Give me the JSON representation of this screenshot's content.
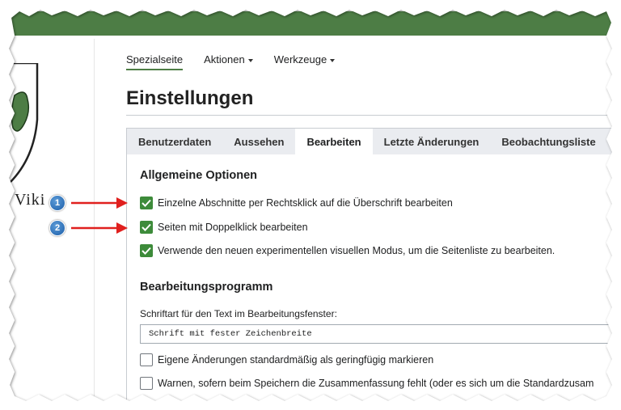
{
  "logo": {
    "text": "Viki"
  },
  "topnav": {
    "items": [
      {
        "label": "Spezialseite"
      },
      {
        "label": "Aktionen"
      },
      {
        "label": "Werkzeuge"
      }
    ]
  },
  "page": {
    "title": "Einstellungen"
  },
  "tabs": [
    {
      "label": "Benutzerdaten"
    },
    {
      "label": "Aussehen"
    },
    {
      "label": "Bearbeiten"
    },
    {
      "label": "Letzte Änderungen"
    },
    {
      "label": "Beobachtungsliste"
    }
  ],
  "general": {
    "title": "Allgemeine Optionen",
    "options": [
      {
        "label": "Einzelne Abschnitte per Rechtsklick auf die Überschrift bearbeiten",
        "checked": true
      },
      {
        "label": "Seiten mit Doppelklick bearbeiten",
        "checked": true
      },
      {
        "label": "Verwende den neuen experimentellen visuellen Modus, um die Seitenliste zu bearbeiten.",
        "checked": true
      }
    ]
  },
  "editor": {
    "title": "Bearbeitungsprogramm",
    "font_label": "Schriftart für den Text im Bearbeitungsfenster:",
    "font_value": "Schrift mit fester Zeichenbreite",
    "options": [
      {
        "label": "Eigene Änderungen standardmäßig als geringfügig markieren",
        "checked": false
      },
      {
        "label": "Warnen, sofern beim Speichern die Zusammenfassung fehlt (oder es sich um die Standardzusam",
        "checked": false
      }
    ]
  },
  "callouts": [
    {
      "number": "1"
    },
    {
      "number": "2"
    }
  ],
  "colors": {
    "header": "#4d7d45",
    "check": "#3d8b3a",
    "arrow": "#e0201e",
    "badge": "#1d5ea8"
  }
}
